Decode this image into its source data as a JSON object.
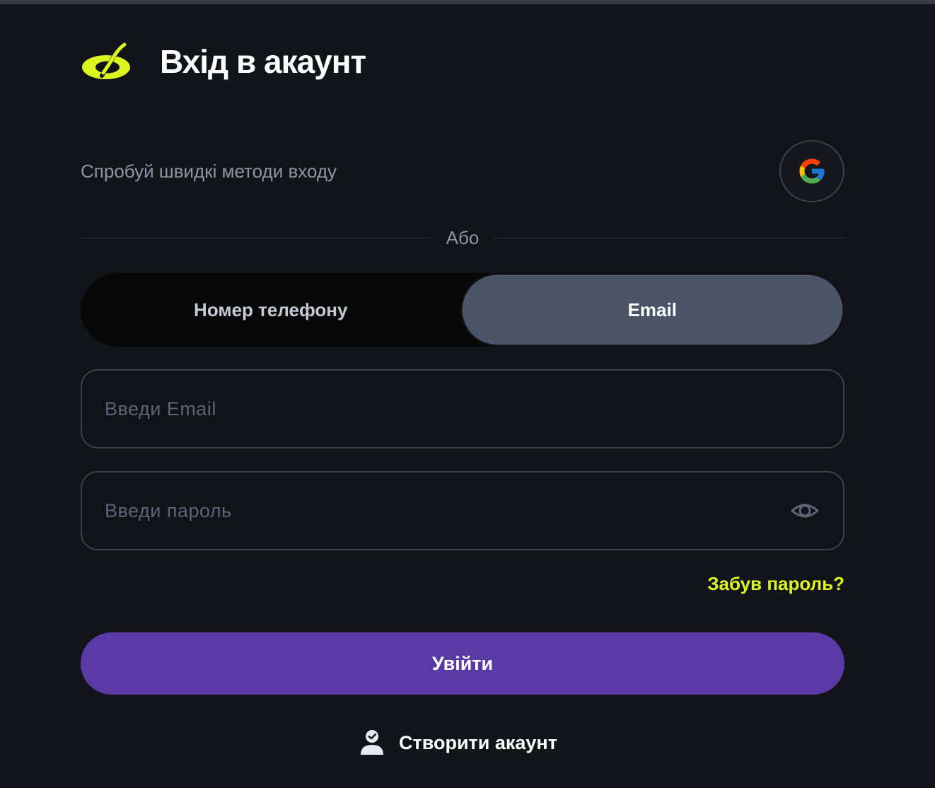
{
  "header": {
    "title": "Вхід в акаунт",
    "logo_icon": "brand-logo-icon",
    "accent_color": "#dcf51e"
  },
  "quick_login": {
    "text": "Спробуй швидкі методи входу",
    "google_icon": "google-icon"
  },
  "divider": {
    "label": "Або"
  },
  "login_method": {
    "options": [
      "Номер телефону",
      "Email"
    ],
    "selected": "Email"
  },
  "email_field": {
    "placeholder": "Введи Email",
    "value": ""
  },
  "password_field": {
    "placeholder": "Введи пароль",
    "value": "",
    "toggle_icon": "eye-icon"
  },
  "forgot_password": {
    "label": "Забув пароль?"
  },
  "submit": {
    "label": "Увійти",
    "color": "#5a3ba5"
  },
  "create_account": {
    "label": "Створити акаунт",
    "icon": "user-check-icon"
  }
}
